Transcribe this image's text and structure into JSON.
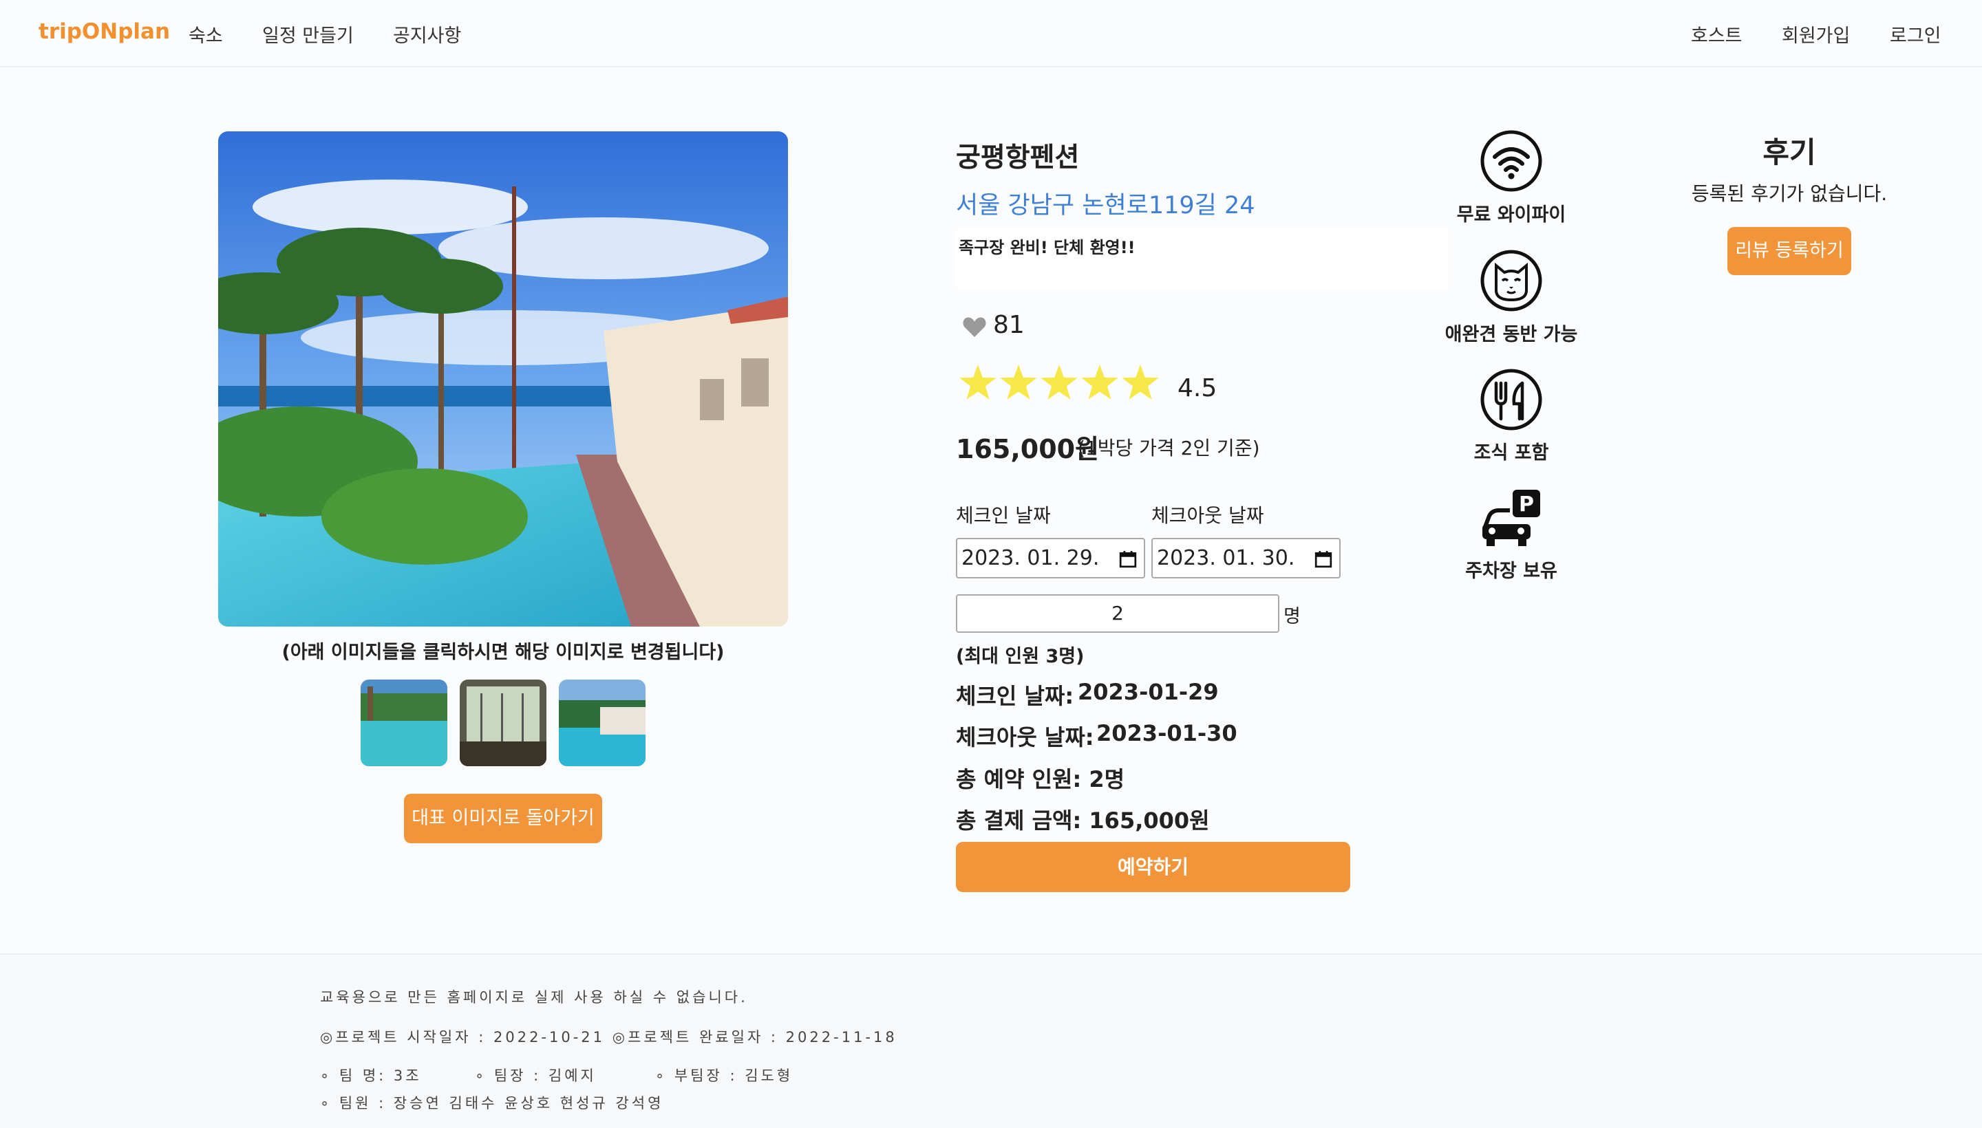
{
  "nav": {
    "brand": "tripONplan",
    "items": [
      "숙소",
      "일정 만들기",
      "공지사항"
    ],
    "right": [
      "호스트",
      "회원가입",
      "로그인"
    ]
  },
  "gallery": {
    "hint": "(아래 이미지들을 클릭하시면 해당 이미지로 변경됩니다)",
    "thumbnail_count": 3,
    "back_button": "대표 이미지로 돌아가기"
  },
  "listing": {
    "name": "궁평항펜션",
    "address": "서울 강남구 논현로119길 24",
    "description": "족구장 완비! 단체 환영!!",
    "likes": "81",
    "rating": "4.5",
    "rating_value": 4.5,
    "rating_max": 5,
    "price": "165,000원",
    "price_note": "(1박당 가격 2인 기준)"
  },
  "booking": {
    "checkin_label": "체크인 날짜",
    "checkout_label": "체크아웃 날짜",
    "checkin_input": "2023. 01. 29.",
    "checkout_input": "2023. 01. 30.",
    "guests": "2",
    "guests_unit": "명",
    "max_guests": "(최대 인원 3명)",
    "summary_checkin_label": "체크인 날짜:",
    "summary_checkin_value": "2023-01-29",
    "summary_checkout_label": "체크아웃 날짜:",
    "summary_checkout_value": "2023-01-30",
    "total_guests": "총 예약 인원: 2명",
    "total_price": "총 결제 금액: 165,000원",
    "book_button": "예약하기"
  },
  "amenities": [
    {
      "label": "무료 와이파이",
      "icon": "wifi-icon"
    },
    {
      "label": "애완견 동반 가능",
      "icon": "cat-icon"
    },
    {
      "label": "조식 포함",
      "icon": "dining-icon"
    },
    {
      "label": "주차장 보유",
      "icon": "parking-car-icon"
    }
  ],
  "reviews": {
    "title": "후기",
    "empty": "등록된 후기가 없습니다.",
    "button": "리뷰 등록하기"
  },
  "footer": {
    "notice": "교육용으로 만든 홈페이지로 실제 사용 하실 수 없습니다.",
    "dates": "◎프로젝트 시작일자 : 2022-10-21 ◎프로젝트 완료일자 : 2022-11-18",
    "team_name": "∘ 팀 명: 3조",
    "leader": "∘ 팀장 : 김예지",
    "subleader": "∘ 부팀장 : 김도형",
    "members": "∘ 팀원 : 장승연 김태수 윤상호 현성규 강석영"
  },
  "colors": {
    "brand": "#f2902f",
    "button": "#f2953a",
    "address": "#3f7fd6",
    "star": "#f7e84a",
    "heart": "#9a9a9a"
  }
}
